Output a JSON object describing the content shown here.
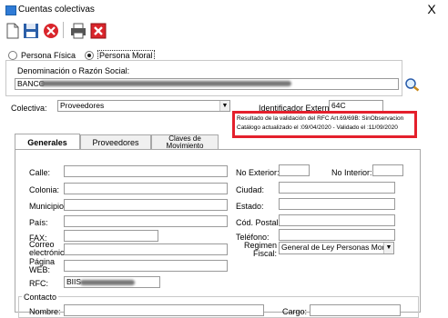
{
  "window": {
    "title": "Cuentas colectivas",
    "close_label": "X"
  },
  "toolbar": {
    "icons": [
      "new-document-icon",
      "save-icon",
      "cancel-icon",
      "print-icon",
      "delete-icon"
    ]
  },
  "person_type": {
    "fisica_label": "Persona Física",
    "moral_label": "Persona Moral",
    "selected": "moral"
  },
  "denominacion": {
    "label": "Denominación o Razón Social:",
    "value": "BANCO"
  },
  "colectiva": {
    "label": "Colectiva:",
    "value": "Proveedores"
  },
  "identificador": {
    "label": "Identificador Externo:",
    "value": "64C"
  },
  "rfc_info": {
    "line1": "Resultado de la validación del RFC Art.69/69B: SinObservacion",
    "line2": "Catálogo actualizado el :09/04/2020 - Validado el :11/09/2020"
  },
  "tabs": {
    "generales": "Generales",
    "proveedores": "Proveedores",
    "claves": "Claves de Movimiento"
  },
  "form": {
    "calle": "Calle:",
    "colonia": "Colonia:",
    "municipio": "Municipio:",
    "pais": "País:",
    "fax": "FAX:",
    "correo": "Correo electrónico",
    "pagina": "Página WEB:",
    "rfc": "RFC:",
    "rfc_value": "BIIS",
    "no_exterior": "No Exterior:",
    "no_interior": "No Interior:",
    "ciudad": "Ciudad:",
    "estado": "Estado:",
    "cod_postal": "Cód. Postal:",
    "telefono": "Teléfono:",
    "regimen": "Regimen Fiscal:",
    "regimen_value": "General de Ley Personas Morale"
  },
  "contacto": {
    "label": "Contacto",
    "nombre": "Nombre:",
    "cargo": "Cargo:"
  },
  "colors": {
    "accent_red": "#e4202c"
  }
}
